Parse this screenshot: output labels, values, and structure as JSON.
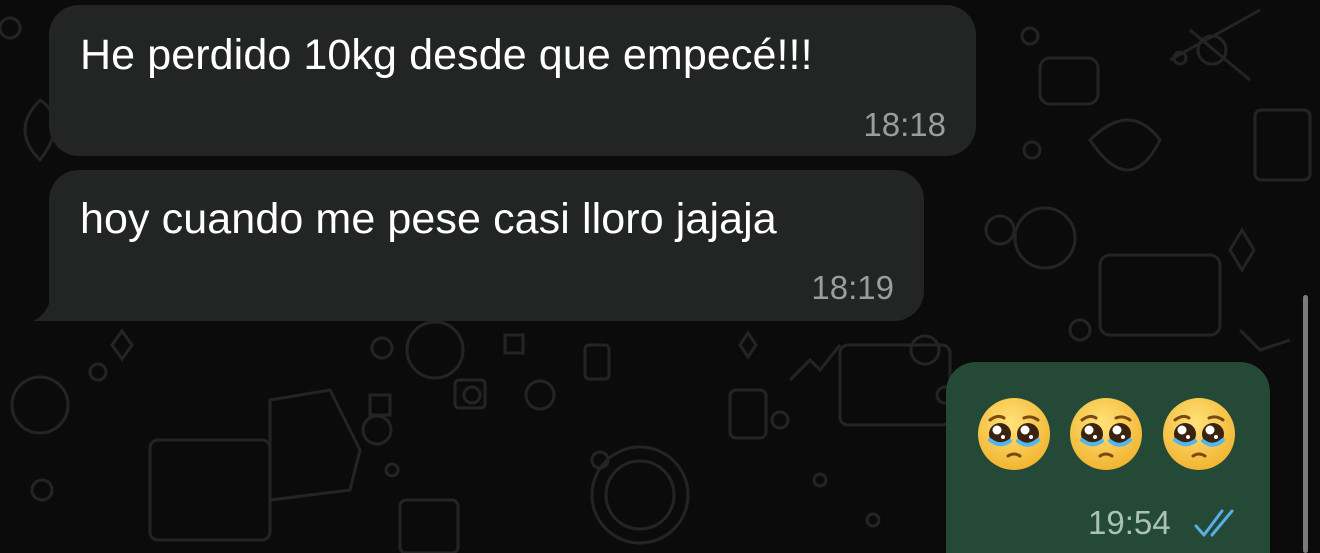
{
  "messages": [
    {
      "direction": "incoming",
      "text": "He perdido 10kg desde que empecé!!!",
      "time": "18:18"
    },
    {
      "direction": "incoming",
      "text": "hoy cuando me pese casi lloro jajaja",
      "time": "18:19"
    },
    {
      "direction": "outgoing",
      "emojis": [
        "pleading-face-icon",
        "pleading-face-icon",
        "pleading-face-icon"
      ],
      "time": "19:54",
      "status": "read"
    }
  ],
  "colors": {
    "background": "#0b0b0b",
    "incoming_bubble": "#232524",
    "outgoing_bubble": "#244a37",
    "read_ticks": "#5aaee5"
  }
}
